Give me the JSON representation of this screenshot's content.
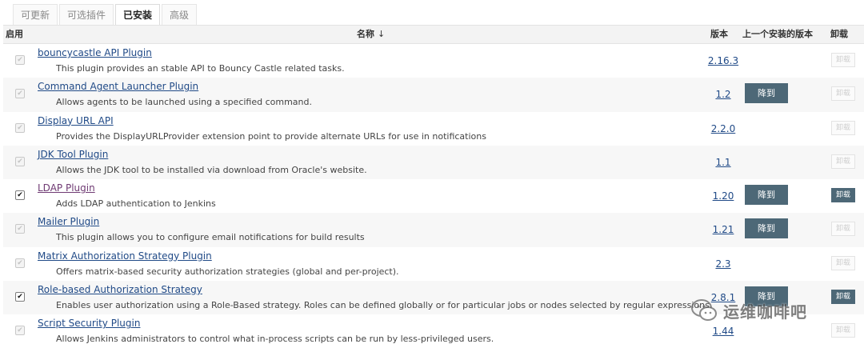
{
  "tabs": [
    {
      "label": "可更新",
      "active": false
    },
    {
      "label": "可选插件",
      "active": false
    },
    {
      "label": "已安装",
      "active": true
    },
    {
      "label": "高级",
      "active": false
    }
  ],
  "table": {
    "headers": {
      "enabled": "启用",
      "name": "名称",
      "name_sort_indicator": "↓",
      "version": "版本",
      "previous_version": "上一个安装的版本",
      "uninstall": "卸载"
    },
    "downgrade_label": "降到",
    "uninstall_label": "卸载",
    "rows": [
      {
        "enabled": true,
        "checkbox_editable": false,
        "name": "bouncycastle API Plugin",
        "description": "This plugin provides an stable API to Bouncy Castle related tasks.",
        "version": "2.16.3",
        "has_downgrade": false,
        "uninstall_enabled": false
      },
      {
        "enabled": true,
        "checkbox_editable": false,
        "name": "Command Agent Launcher Plugin",
        "description": "Allows agents to be launched using a specified command.",
        "version": "1.2",
        "has_downgrade": true,
        "uninstall_enabled": false
      },
      {
        "enabled": true,
        "checkbox_editable": false,
        "name": "Display URL API",
        "description": "Provides the DisplayURLProvider extension point to provide alternate URLs for use in notifications",
        "version": "2.2.0",
        "has_downgrade": false,
        "uninstall_enabled": false
      },
      {
        "enabled": true,
        "checkbox_editable": false,
        "name": "JDK Tool Plugin",
        "description": "Allows the JDK tool to be installed via download from Oracle's website.",
        "version": "1.1",
        "has_downgrade": false,
        "uninstall_enabled": false
      },
      {
        "enabled": true,
        "checkbox_editable": true,
        "name": "LDAP Plugin",
        "description": "Adds LDAP authentication to Jenkins",
        "version": "1.20",
        "has_downgrade": true,
        "uninstall_enabled": true,
        "link_visited": true
      },
      {
        "enabled": true,
        "checkbox_editable": false,
        "name": "Mailer Plugin",
        "description": "This plugin allows you to configure email notifications for build results",
        "version": "1.21",
        "has_downgrade": true,
        "uninstall_enabled": false
      },
      {
        "enabled": true,
        "checkbox_editable": false,
        "name": "Matrix Authorization Strategy Plugin",
        "description": "Offers matrix-based security authorization strategies (global and per-project).",
        "version": "2.3",
        "has_downgrade": false,
        "uninstall_enabled": false
      },
      {
        "enabled": true,
        "checkbox_editable": true,
        "name": "Role-based Authorization Strategy",
        "description": "Enables user authorization using a Role-Based strategy. Roles can be defined globally or for particular jobs or nodes selected by regular expressions.",
        "version": "2.8.1",
        "has_downgrade": true,
        "uninstall_enabled": true
      },
      {
        "enabled": true,
        "checkbox_editable": false,
        "name": "Script Security Plugin",
        "description": "Allows Jenkins administrators to control what in-process scripts can be run by less-privileged users.",
        "version": "1.44",
        "has_downgrade": false,
        "uninstall_enabled": false
      }
    ]
  },
  "watermark": {
    "text": "运维咖啡吧",
    "icon": "wechat-logo-icon"
  },
  "colors": {
    "link": "#204a87",
    "link_visited": "#6f3a73",
    "button_bg": "#4d6877",
    "header_bg": "#f3f3f3",
    "row_alt_bg": "#f7f7f7"
  }
}
